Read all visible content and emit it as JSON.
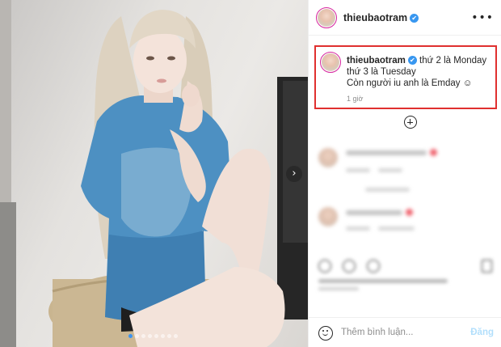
{
  "post": {
    "photo_alt": "Photo of a woman with long blonde hair in a blue t-shirt sitting on a stool",
    "carousel": {
      "total": 8,
      "active_index": 0,
      "next_icon": "chevron-right-icon"
    }
  },
  "header": {
    "username": "thieubaotram",
    "verified": "✔",
    "more_icon": "•••"
  },
  "caption": {
    "username": "thieubaotram",
    "line1": "thứ 2 là Monday",
    "line2": "thứ 3 là Tuesday",
    "line3": "Còn người iu anh là Emday ☺",
    "time": "1 giờ",
    "highlight_color": "#e0302f"
  },
  "comment_box": {
    "placeholder": "Thêm bình luận...",
    "post_label": "Đăng",
    "post_color": "#b2dffc"
  },
  "colors": {
    "verified": "#3897f0",
    "text": "#262626",
    "muted": "#8e8e8e"
  }
}
